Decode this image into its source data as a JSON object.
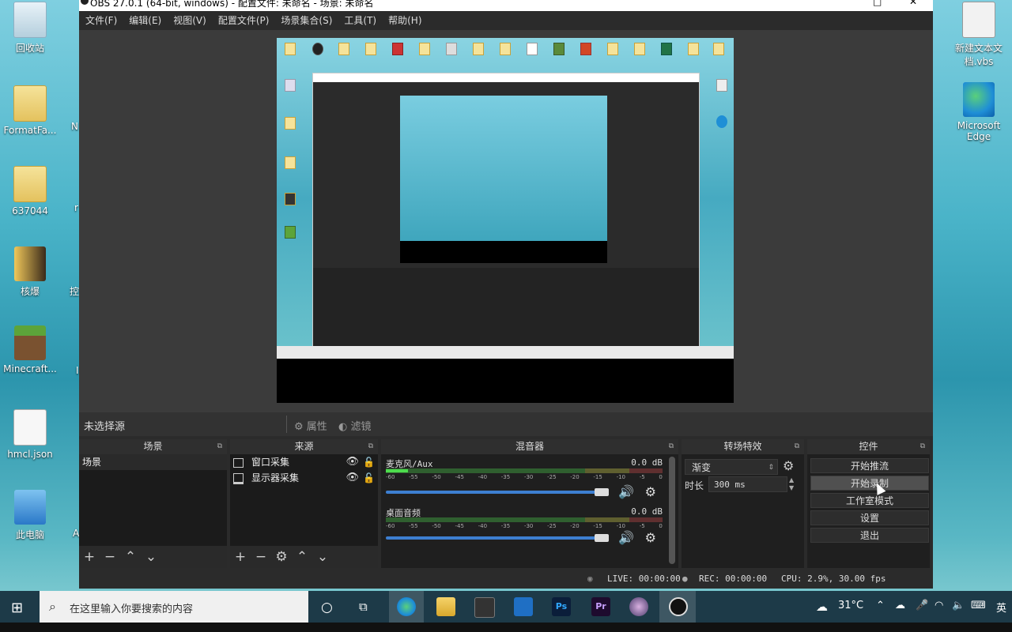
{
  "desktop": {
    "left_icons": [
      {
        "label": "回收站",
        "icon": "recycle-bin-icon"
      },
      {
        "label": "FormatFa...",
        "icon": "folder-icon"
      },
      {
        "label": "637044",
        "icon": "folder-icon"
      },
      {
        "label": "核爆",
        "icon": "book-icon"
      },
      {
        "label": "Minecraft...",
        "icon": "minecraft-icon"
      },
      {
        "label": "hmcl.json",
        "icon": "document-icon"
      },
      {
        "label": "此电脑",
        "icon": "computer-icon"
      }
    ],
    "left_partial": [
      "N",
      "r",
      "控",
      "I",
      "A"
    ],
    "right_icons": [
      {
        "label": "新建文本文档.vbs",
        "icon": "script-icon"
      },
      {
        "label": "Microsoft Edge",
        "icon": "edge-icon"
      }
    ]
  },
  "window": {
    "title": "OBS 27.0.1 (64-bit, windows) - 配置文件: 未命名 - 场景: 未命名",
    "controls": [
      "—",
      "□",
      "✕"
    ]
  },
  "menu": [
    "文件(F)",
    "编辑(E)",
    "视图(V)",
    "配置文件(P)",
    "场景集合(S)",
    "工具(T)",
    "帮助(H)"
  ],
  "source_bar": {
    "no_source": "未选择源",
    "properties": "属性",
    "filters": "滤镜"
  },
  "docks": {
    "scenes": {
      "title": "场景",
      "items": [
        "场景"
      ]
    },
    "sources": {
      "title": "来源",
      "items": [
        {
          "label": "窗口采集",
          "icon": "window-capture-icon"
        },
        {
          "label": "显示器采集",
          "icon": "display-capture-icon"
        }
      ]
    },
    "mixer": {
      "title": "混音器",
      "channels": [
        {
          "name": "麦克风/Aux",
          "db": "0.0 dB",
          "level": 0.08
        },
        {
          "name": "桌面音频",
          "db": "0.0 dB",
          "level": 0.0
        }
      ],
      "ticks": [
        "-60",
        "-55",
        "-50",
        "-45",
        "-40",
        "-35",
        "-30",
        "-25",
        "-20",
        "-15",
        "-10",
        "-5",
        "0"
      ]
    },
    "transitions": {
      "title": "转场特效",
      "transition": "渐变",
      "duration_label": "时长",
      "duration": "300 ms"
    },
    "controls": {
      "title": "控件",
      "buttons": [
        "开始推流",
        "开始录制",
        "工作室模式",
        "设置",
        "退出"
      ]
    }
  },
  "status": {
    "live": "LIVE: 00:00:00",
    "rec": "REC: 00:00:00",
    "cpu": "CPU: 2.9%, 30.00 fps"
  },
  "taskbar": {
    "search_placeholder": "在这里输入你要搜索的内容",
    "weather": "31°C",
    "ime": "英",
    "apps": [
      "edge-icon",
      "file-explorer-icon",
      "store-icon",
      "mail-icon",
      "photoshop-icon",
      "premiere-icon",
      "app-icon",
      "obs-icon"
    ],
    "ps_label": "Ps",
    "pr_label": "Pr"
  }
}
